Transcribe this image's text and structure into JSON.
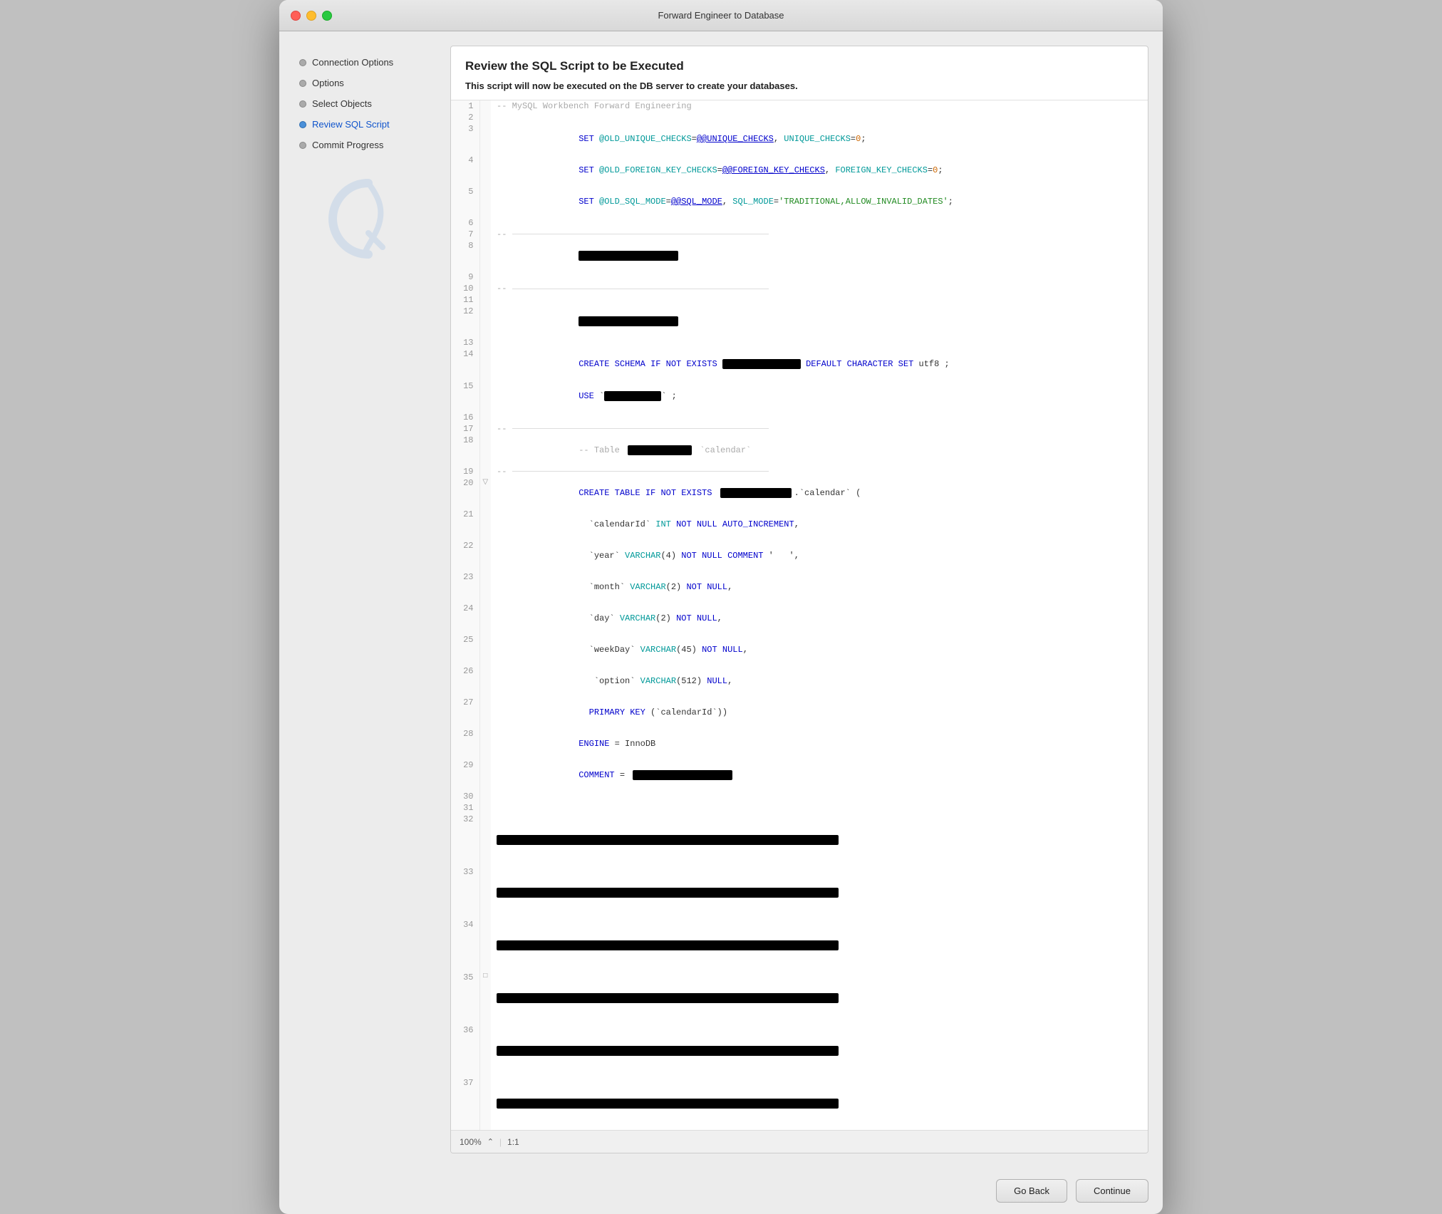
{
  "window": {
    "title": "Forward Engineer to Database"
  },
  "titlebar": {
    "close": "close",
    "minimize": "minimize",
    "maximize": "maximize"
  },
  "sidebar": {
    "items": [
      {
        "id": "connection-options",
        "label": "Connection Options",
        "state": "inactive"
      },
      {
        "id": "options",
        "label": "Options",
        "state": "inactive"
      },
      {
        "id": "select-objects",
        "label": "Select Objects",
        "state": "inactive"
      },
      {
        "id": "review-sql-script",
        "label": "Review SQL Script",
        "state": "active"
      },
      {
        "id": "commit-progress",
        "label": "Commit Progress",
        "state": "inactive"
      }
    ]
  },
  "main": {
    "header_title": "Review the SQL Script to be Executed",
    "header_body": "This script will now be executed on the DB server to create your databases."
  },
  "footer": {
    "go_back": "Go Back",
    "continue": "Continue"
  },
  "code": {
    "zoom_label": "100%",
    "position_label": "1:1"
  }
}
